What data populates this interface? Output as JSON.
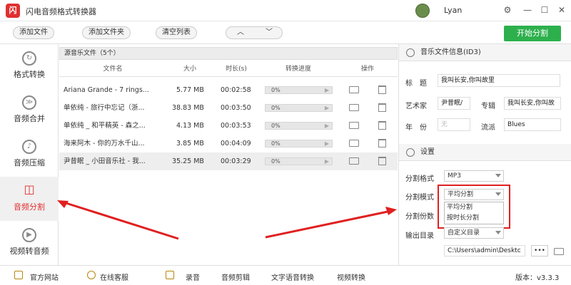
{
  "app": {
    "title": "闪电音频格式转换器",
    "logo": "闪",
    "user": "Lyan"
  },
  "window": {
    "settings": "⚙",
    "min": "—",
    "max": "☐",
    "close": "✕"
  },
  "toolbar": {
    "add_file": "添加文件",
    "add_folder": "添加文件夹",
    "clear_list": "清空列表",
    "up": "︿",
    "down": "﹀",
    "start": "开始分割"
  },
  "sidebar": {
    "items": [
      {
        "label": "格式转换",
        "icon": "↻"
      },
      {
        "label": "音频合并",
        "icon": "≫"
      },
      {
        "label": "音频压缩",
        "icon": "♪"
      },
      {
        "label": "音频分割",
        "icon": "◫"
      },
      {
        "label": "视频转音频",
        "icon": "▶"
      }
    ]
  },
  "filelist": {
    "header": "源音乐文件（5个）",
    "columns": [
      "文件名",
      "大小",
      "时长(s)",
      "转换进度",
      "操作"
    ],
    "rows": [
      {
        "name": "Ariana Grande - 7 rings...",
        "size": "5.77 MB",
        "duration": "00:02:58",
        "progress": "0%"
      },
      {
        "name": "单依纯 - 旅行中忘记（浙...",
        "size": "38.83 MB",
        "duration": "00:03:50",
        "progress": "0%"
      },
      {
        "name": "单依纯 _ 和平精英 - 森之...",
        "size": "4.13 MB",
        "duration": "00:03:53",
        "progress": "0%"
      },
      {
        "name": "海来阿木 - 你的万水千山...",
        "size": "3.85 MB",
        "duration": "00:04:09",
        "progress": "0%"
      },
      {
        "name": "尹昔眠 _ 小田音乐社 - 我...",
        "size": "35.25 MB",
        "duration": "00:03:29",
        "progress": "0%"
      }
    ]
  },
  "id3": {
    "header": "音乐文件信息(ID3)",
    "title_label": "标　题",
    "title_value": "我叫长安,你叫故里",
    "artist_label": "艺术家",
    "artist_value": "尹昔眠/",
    "album_label": "专辑",
    "album_value": "我叫长安,你叫故",
    "year_label": "年　份",
    "year_value": "无",
    "genre_label": "流派",
    "genre_value": "Blues"
  },
  "settings": {
    "header": "设置",
    "format_label": "分割格式",
    "format_value": "MP3",
    "mode_label": "分割模式",
    "mode_value": "平均分割",
    "mode_options": [
      "平均分割",
      "按时长分割"
    ],
    "count_label": "分割份数",
    "output_label": "输出目录",
    "output_value": "自定义目录",
    "path_value": "C:\\Users\\admin\\Desktc",
    "more": "•••"
  },
  "statusbar": {
    "website": "官方网站",
    "service": "在线客服",
    "record": "录音",
    "edit": "音频剪辑",
    "tts": "文字语音转换",
    "video": "视频转换",
    "version": "版本：v3.3.3"
  }
}
